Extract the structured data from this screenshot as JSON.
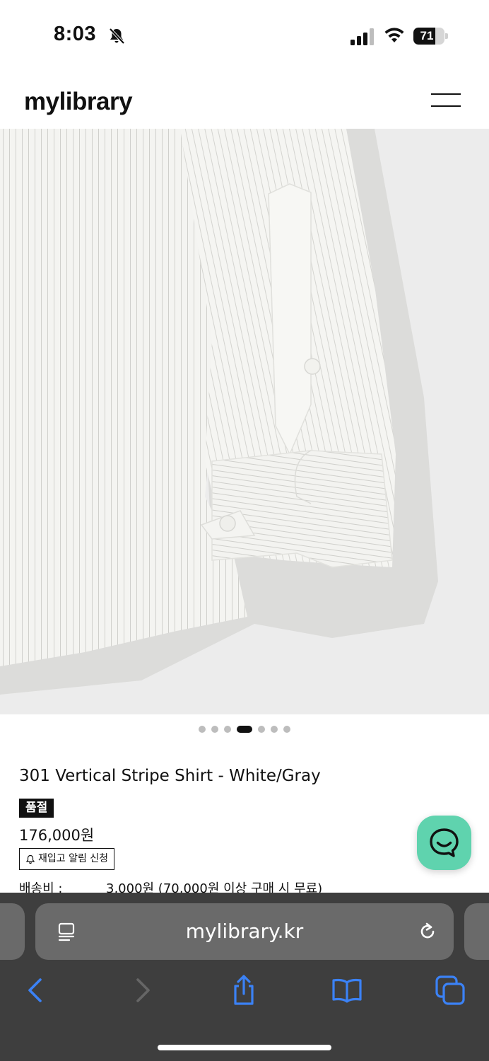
{
  "status_bar": {
    "time": "8:03",
    "battery_level": "71",
    "battery_fraction": 0.71
  },
  "header": {
    "logo": "mylibrary"
  },
  "carousel": {
    "total": 7,
    "active_index": 3
  },
  "product": {
    "title": "301 Vertical Stripe Shirt - White/Gray",
    "status_badge": "품절",
    "price": "176,000원",
    "restock_label": "재입고 알림 신청",
    "shipping_label": "배송비 :",
    "shipping_value": "3,000원 (70,000원 이상 구매 시 무료)"
  },
  "browser": {
    "url": "mylibrary.kr"
  },
  "colors": {
    "chat_button": "#5fd3ae",
    "safari_bar": "#3e3e3e",
    "address_bar": "#6a6a6a",
    "toolbar_icon": "#3b82f6"
  },
  "icons": {
    "bell": "bell-slash-icon",
    "signal": "cellular-signal-icon",
    "wifi": "wifi-icon",
    "battery": "battery-icon",
    "menu": "hamburger-menu-icon",
    "chat": "chat-bubble-icon",
    "reader": "reader-mode-icon",
    "reload": "reload-icon",
    "back": "chevron-left-icon",
    "forward": "chevron-right-icon",
    "share": "share-icon",
    "bookmarks": "open-book-icon",
    "tabs": "tabs-icon"
  }
}
